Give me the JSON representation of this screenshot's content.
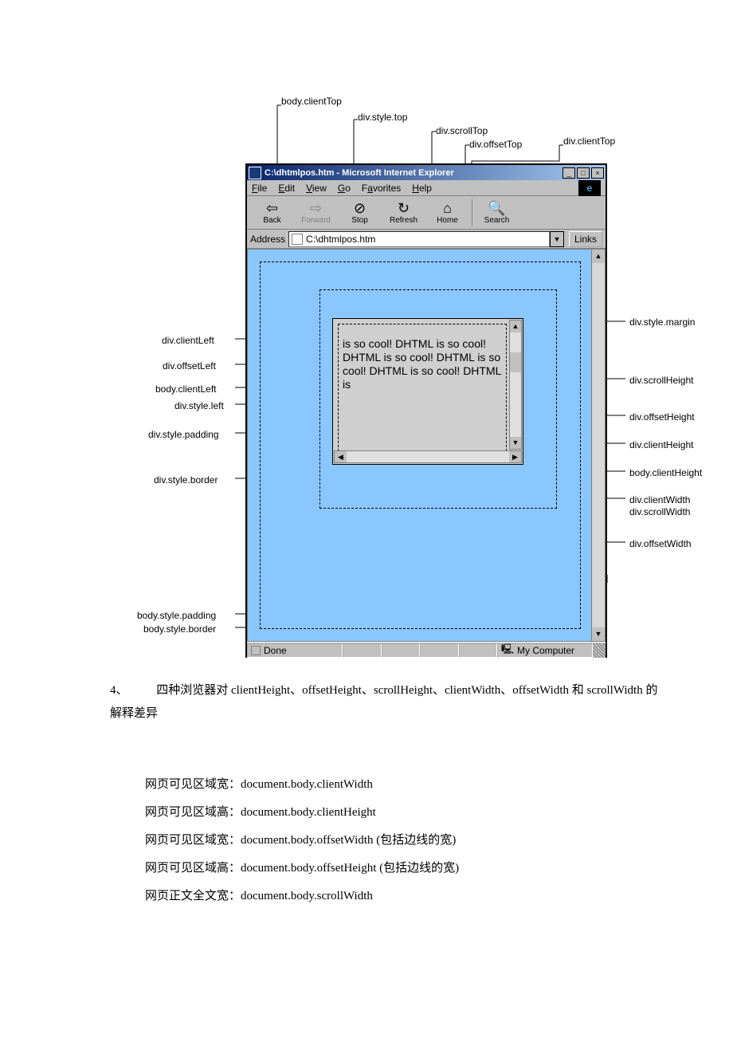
{
  "labels": {
    "top": {
      "body_clientTop": "body.clientTop",
      "div_style_top": "div.style.top",
      "div_scrollTop": "div.scrollTop",
      "div_offsetTop": "div.offsetTop",
      "div_clientTop": "div.clientTop"
    },
    "left": {
      "div_clientLeft": "div.clientLeft",
      "div_offsetLeft": "div.offsetLeft",
      "body_clientLeft": "body.clientLeft",
      "div_style_left": "div.style.left",
      "div_style_padding": "div.style.padding",
      "div_style_border": "div.style.border",
      "body_style_padding": "body.style.padding",
      "body_style_border": "body.style.border"
    },
    "right": {
      "div_style_margin": "div.style.margin",
      "div_scrollHeight": "div.scrollHeight",
      "div_offsetHeight": "div.offsetHeight",
      "div_clientHeight": "div.clientHeight",
      "body_clientHeight": "body.clientHeight",
      "div_clientWidth": "div.clientWidth",
      "div_scrollWidth": "div.scrollWidth",
      "div_offsetWidth": "div.offsetWidth"
    }
  },
  "measures": {
    "body_clientWidth": "body.clientWidth",
    "body_offsetWidth": "body.offsetWidth"
  },
  "browser": {
    "title": "C:\\dhtmlpos.htm - Microsoft Internet Explorer",
    "menu": {
      "file": "File",
      "edit": "Edit",
      "view": "View",
      "go": "Go",
      "favorites": "Favorites",
      "help": "Help"
    },
    "toolbar": {
      "back": "Back",
      "forward": "Forward",
      "stop": "Stop",
      "refresh": "Refresh",
      "home": "Home",
      "search": "Search"
    },
    "address_label": "Address",
    "address": "C:\\dhtmlpos.htm",
    "links": "Links",
    "div_text": "is so cool!\nDHTML is so cool! DHTML is so cool! DHTML is so cool!\nDHTML is so cool! DHTML is",
    "status_done": "Done",
    "status_zone": "My Computer"
  },
  "section4": {
    "num": "4、",
    "heading": "四种浏览器对 clientHeight、offsetHeight、scrollHeight、clientWidth、offsetWidth 和 scrollWidth 的解释差异"
  },
  "defs": {
    "d1": "网页可见区域宽：document.body.clientWidth",
    "d2": "网页可见区域高：document.body.clientHeight",
    "d3": "网页可见区域宽：document.body.offsetWidth (包括边线的宽)",
    "d4": "网页可见区域高：document.body.offsetHeight (包括边线的宽)",
    "d5": "网页正文全文宽：document.body.scrollWidth"
  }
}
